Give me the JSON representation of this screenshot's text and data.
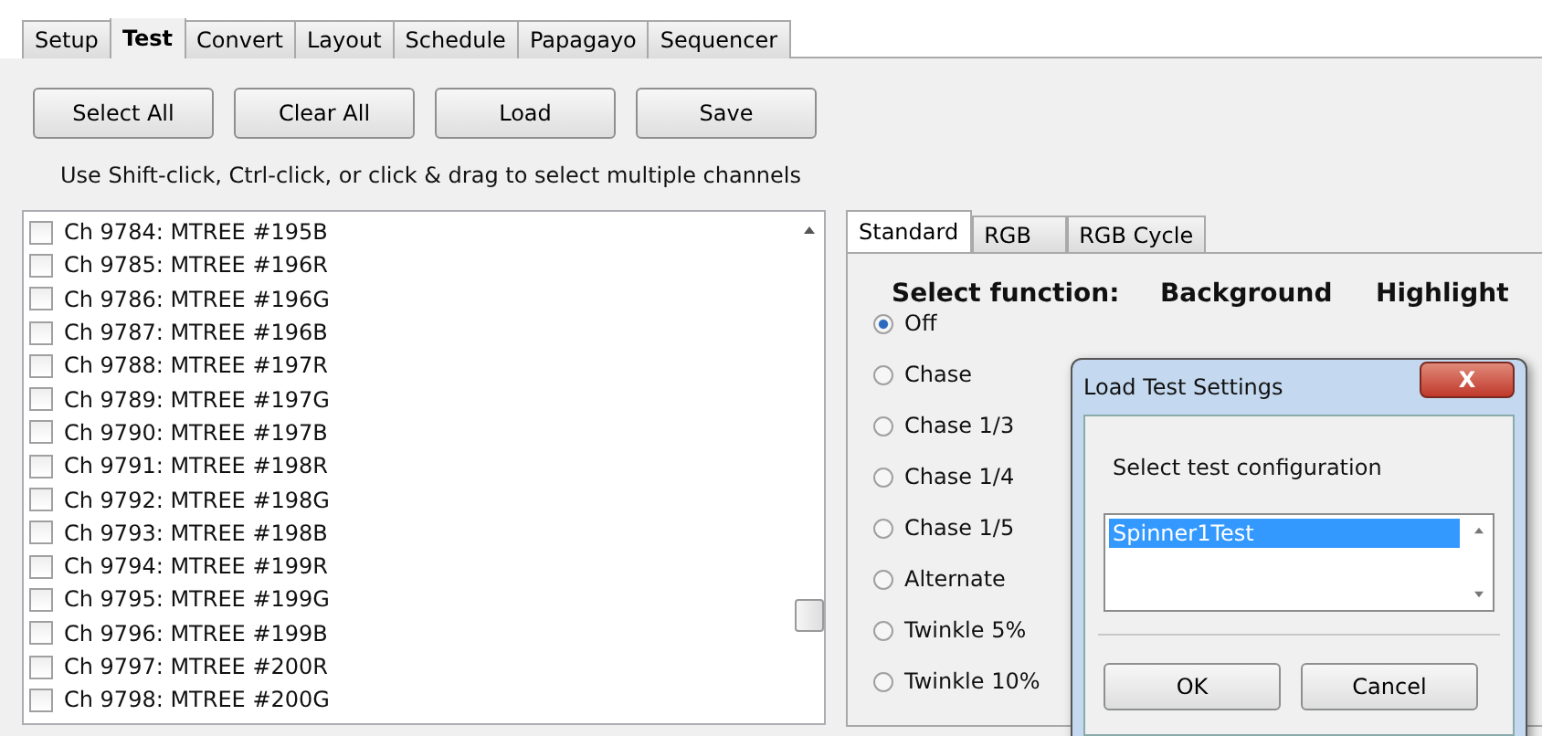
{
  "tabs": [
    {
      "label": "Setup",
      "selected": false
    },
    {
      "label": "Test",
      "selected": true
    },
    {
      "label": "Convert",
      "selected": false
    },
    {
      "label": "Layout",
      "selected": false
    },
    {
      "label": "Schedule",
      "selected": false
    },
    {
      "label": "Papagayo",
      "selected": false
    },
    {
      "label": "Sequencer",
      "selected": false
    }
  ],
  "buttons": [
    "Select All",
    "Clear All",
    "Load",
    "Save"
  ],
  "hint": "Use Shift-click, Ctrl-click, or click & drag to select multiple channels",
  "channels": [
    {
      "label": "Ch 9784: MTREE #195B",
      "checked": false
    },
    {
      "label": "Ch 9785: MTREE #196R",
      "checked": false
    },
    {
      "label": "Ch 9786: MTREE #196G",
      "checked": false
    },
    {
      "label": "Ch 9787: MTREE #196B",
      "checked": false
    },
    {
      "label": "Ch 9788: MTREE #197R",
      "checked": false
    },
    {
      "label": "Ch 9789: MTREE #197G",
      "checked": false
    },
    {
      "label": "Ch 9790: MTREE #197B",
      "checked": false
    },
    {
      "label": "Ch 9791: MTREE #198R",
      "checked": false
    },
    {
      "label": "Ch 9792: MTREE #198G",
      "checked": false
    },
    {
      "label": "Ch 9793: MTREE #198B",
      "checked": false
    },
    {
      "label": "Ch 9794: MTREE #199R",
      "checked": false
    },
    {
      "label": "Ch 9795: MTREE #199G",
      "checked": false
    },
    {
      "label": "Ch 9796: MTREE #199B",
      "checked": false
    },
    {
      "label": "Ch 9797: MTREE #200R",
      "checked": false
    },
    {
      "label": "Ch 9798: MTREE #200G",
      "checked": false
    }
  ],
  "function_tabs": [
    {
      "label": "Standard",
      "selected": true
    },
    {
      "label": "RGB",
      "selected": false
    },
    {
      "label": "RGB Cycle",
      "selected": false
    }
  ],
  "headings": [
    "Select function:",
    "Background",
    "Highlight"
  ],
  "functions": [
    {
      "label": "Off",
      "selected": true
    },
    {
      "label": "Chase",
      "selected": false
    },
    {
      "label": "Chase 1/3",
      "selected": false
    },
    {
      "label": "Chase 1/4",
      "selected": false
    },
    {
      "label": "Chase 1/5",
      "selected": false
    },
    {
      "label": "Alternate",
      "selected": false
    },
    {
      "label": "Twinkle 5%",
      "selected": false
    },
    {
      "label": "Twinkle 10%",
      "selected": false
    }
  ],
  "dialog": {
    "title": "Load Test Settings",
    "close": "X",
    "prompt": "Select test configuration",
    "configurations": [
      {
        "label": "Spinner1Test",
        "selected": true
      }
    ],
    "buttons": [
      "OK",
      "Cancel"
    ]
  }
}
